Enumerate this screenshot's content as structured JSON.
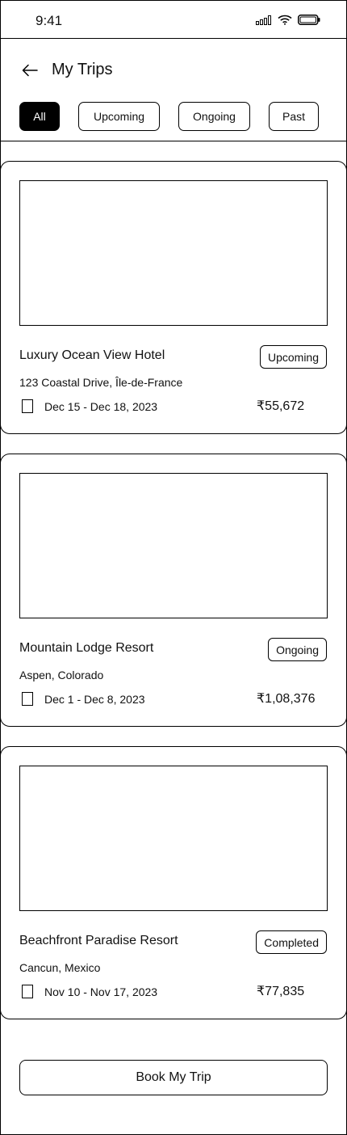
{
  "status_bar": {
    "time": "9:41",
    "icons": [
      "signal-icon",
      "wifi-icon",
      "battery-icon"
    ]
  },
  "header": {
    "back_icon": "arrow-left-icon",
    "title": "My Trips"
  },
  "filters": {
    "tabs": [
      {
        "label": "All",
        "active": true
      },
      {
        "label": "Upcoming",
        "active": false
      },
      {
        "label": "Ongoing",
        "active": false
      },
      {
        "label": "Past",
        "active": false
      }
    ]
  },
  "trips": [
    {
      "name": "Luxury Ocean View Hotel",
      "status": "Upcoming",
      "location": "123 Coastal Drive, Île-de-France",
      "dates": "Dec 15 - Dec 18, 2023",
      "price": "₹55,672"
    },
    {
      "name": "Mountain Lodge Resort",
      "status": "Ongoing",
      "location": "Aspen, Colorado",
      "dates": "Dec 1 - Dec 8, 2023",
      "price": "₹1,08,376"
    },
    {
      "name": "Beachfront Paradise Resort",
      "status": "Completed",
      "location": "Cancun, Mexico",
      "dates": "Nov 10 - Nov 17, 2023",
      "price": "₹77,835"
    }
  ],
  "actions": {
    "book_label": "Book My Trip"
  },
  "colors": {
    "ink": "#000000",
    "background": "#ffffff"
  }
}
